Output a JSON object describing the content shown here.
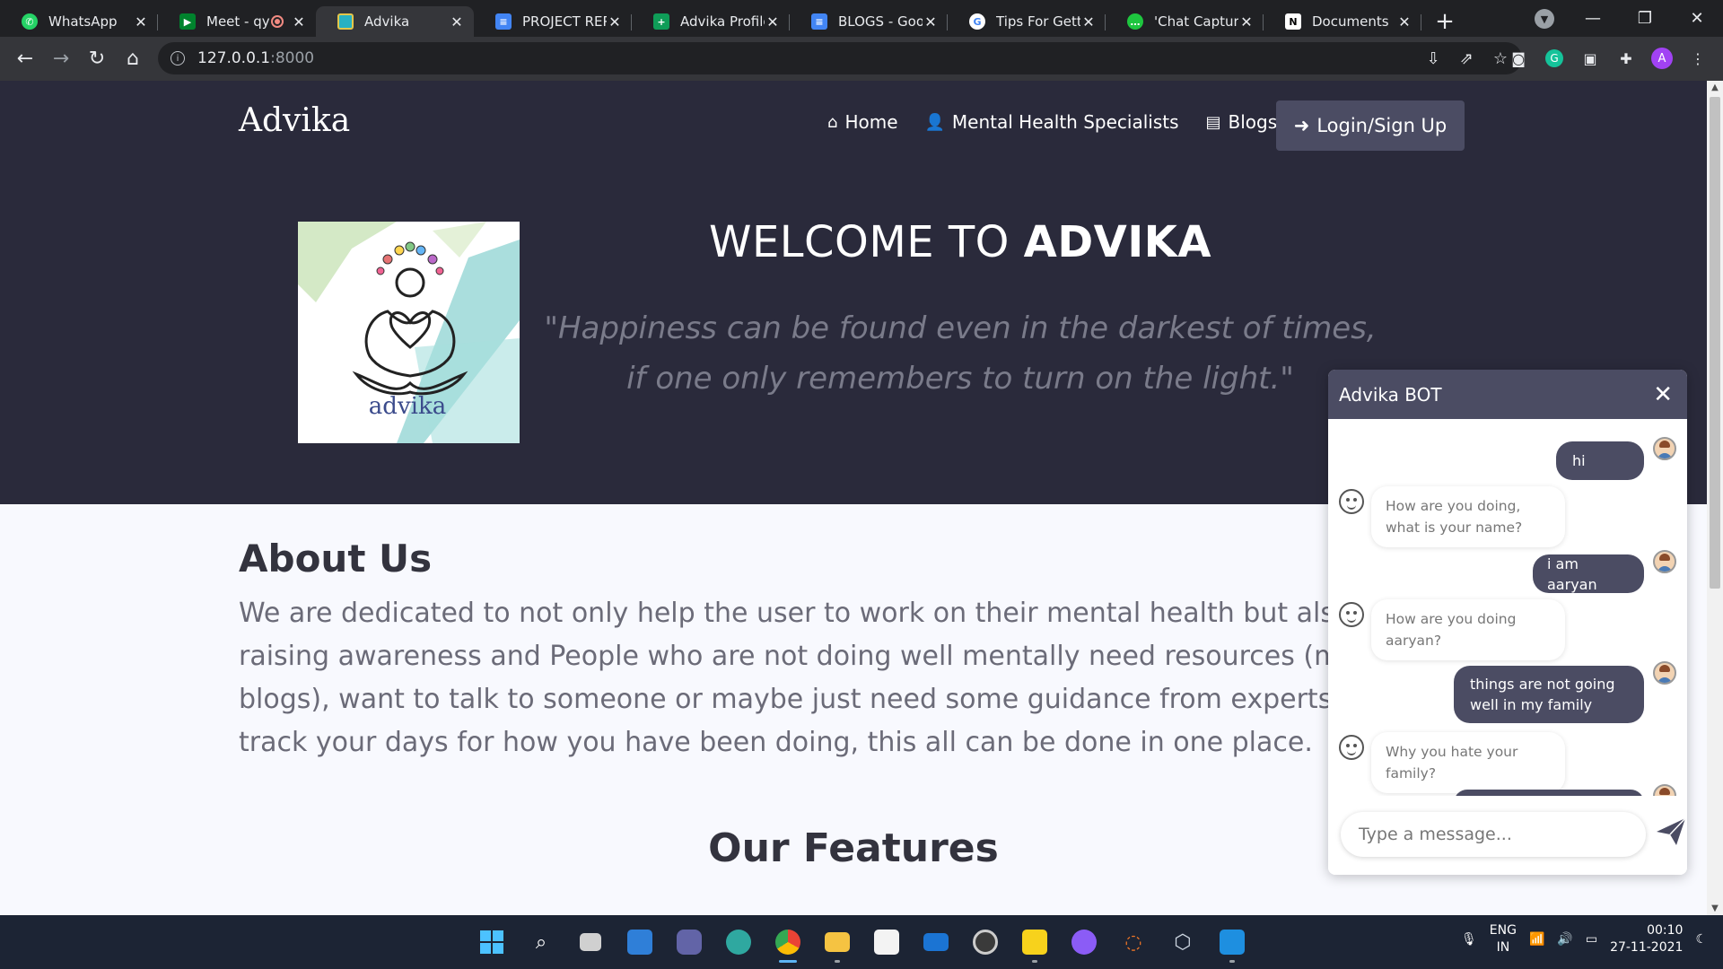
{
  "browser": {
    "tabs": [
      {
        "title": "WhatsApp",
        "favicon_color": "#25d366",
        "icon": "whatsapp-icon"
      },
      {
        "title": "Meet - qy",
        "favicon_color": "#00832d",
        "icon": "meet-icon",
        "recording": true
      },
      {
        "title": "Advika",
        "favicon_color": "#28b1c2",
        "icon": "advika-icon",
        "active": true
      },
      {
        "title": "PROJECT REPC",
        "favicon_color": "#4285f4",
        "icon": "docs-icon"
      },
      {
        "title": "Advika Profile:",
        "favicon_color": "#0f9d58",
        "icon": "sheets-icon"
      },
      {
        "title": "BLOGS - Goog",
        "favicon_color": "#4285f4",
        "icon": "docs-icon"
      },
      {
        "title": "Tips For Gettin",
        "favicon_color": "#ffffff",
        "icon": "google-icon"
      },
      {
        "title": "'Chat Capture'",
        "favicon_color": "#1ec63f",
        "icon": "chat-icon"
      },
      {
        "title": "Documents",
        "favicon_color": "#202124",
        "icon": "notion-icon"
      }
    ],
    "address": {
      "host": "127.0.0.1",
      "port": ":8000"
    }
  },
  "site": {
    "brand": "Advika",
    "nav": {
      "home": "Home",
      "specialists": "Mental Health Specialists",
      "blogs": "Blogs",
      "login": "Login/Sign Up"
    },
    "hero": {
      "welcome_prefix": "WELCOME TO ",
      "welcome_brand": "ADVIKA",
      "quote_line1": "\"Happiness can be found even in the darkest of times,",
      "quote_line2": "if one only remembers to turn on the light.\""
    },
    "logo_caption": "advika",
    "about": {
      "title": "About Us",
      "lines": [
        "We are dedicated to not only help the user to work on their mental health but also",
        "raising awareness and People who are not doing well mentally need resources (m",
        "blogs), want to talk to someone or maybe just need some guidance from experts",
        "track your days for how you have been doing, this all can be done in one place."
      ]
    },
    "features_title": "Our Features"
  },
  "chat": {
    "title": "Advika BOT",
    "messages": [
      {
        "from": "user",
        "text": "hi"
      },
      {
        "from": "bot",
        "line1": "How are you doing,",
        "line2": "what is your name?"
      },
      {
        "from": "user",
        "text": "i am aaryan"
      },
      {
        "from": "bot",
        "line1": "How are you doing",
        "line2": "aaryan?"
      },
      {
        "from": "user",
        "line1": "things are not going",
        "line2": "well in my family"
      },
      {
        "from": "bot",
        "line1": "Why you hate your",
        "line2": "family?"
      }
    ],
    "input_placeholder": "Type a message..."
  },
  "taskbar": {
    "lang_line1": "ENG",
    "lang_line2": "IN",
    "time": "00:10",
    "date": "27-11-2021"
  },
  "colors": {
    "hero_bg": "#2a2a3b",
    "accent": "#4b4c63",
    "page_bg": "#f8f9fe"
  }
}
